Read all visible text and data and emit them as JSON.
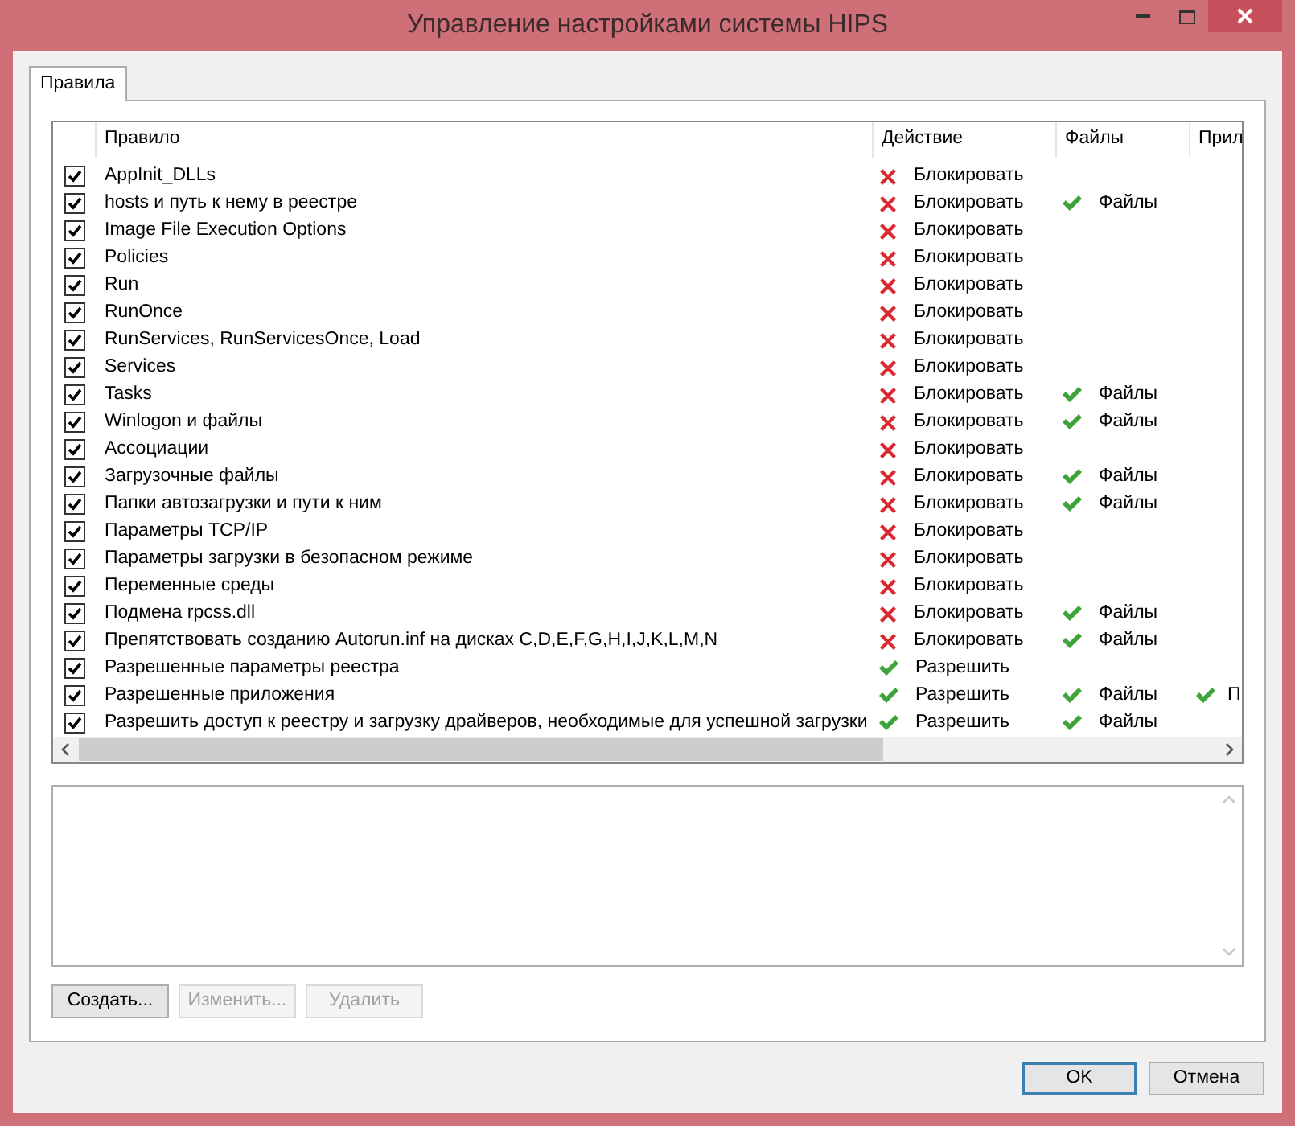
{
  "window": {
    "title": "Управление настройками системы HIPS"
  },
  "tabs": [
    {
      "label": "Правила",
      "selected": true
    }
  ],
  "table": {
    "columns": [
      "Правило",
      "Действие",
      "Файлы",
      "Прил"
    ],
    "rows": [
      {
        "checked": true,
        "rule": "AppInit_DLLs",
        "action": {
          "kind": "block",
          "label": "Блокировать"
        }
      },
      {
        "checked": true,
        "rule": "hosts и путь к нему в реестре",
        "action": {
          "kind": "block",
          "label": "Блокировать"
        },
        "files": "Файлы"
      },
      {
        "checked": true,
        "rule": "Image File Execution Options",
        "action": {
          "kind": "block",
          "label": "Блокировать"
        }
      },
      {
        "checked": true,
        "rule": "Policies",
        "action": {
          "kind": "block",
          "label": "Блокировать"
        }
      },
      {
        "checked": true,
        "rule": "Run",
        "action": {
          "kind": "block",
          "label": "Блокировать"
        }
      },
      {
        "checked": true,
        "rule": "RunOnce",
        "action": {
          "kind": "block",
          "label": "Блокировать"
        }
      },
      {
        "checked": true,
        "rule": "RunServices, RunServicesOnce, Load",
        "action": {
          "kind": "block",
          "label": "Блокировать"
        }
      },
      {
        "checked": true,
        "rule": "Services",
        "action": {
          "kind": "block",
          "label": "Блокировать"
        }
      },
      {
        "checked": true,
        "rule": "Tasks",
        "action": {
          "kind": "block",
          "label": "Блокировать"
        },
        "files": "Файлы"
      },
      {
        "checked": true,
        "rule": "Winlogon и файлы",
        "action": {
          "kind": "block",
          "label": "Блокировать"
        },
        "files": "Файлы"
      },
      {
        "checked": true,
        "rule": "Ассоциации",
        "action": {
          "kind": "block",
          "label": "Блокировать"
        }
      },
      {
        "checked": true,
        "rule": "Загрузочные файлы",
        "action": {
          "kind": "block",
          "label": "Блокировать"
        },
        "files": "Файлы"
      },
      {
        "checked": true,
        "rule": "Папки автозагрузки и пути к ним",
        "action": {
          "kind": "block",
          "label": "Блокировать"
        },
        "files": "Файлы"
      },
      {
        "checked": true,
        "rule": "Параметры TCP/IP",
        "action": {
          "kind": "block",
          "label": "Блокировать"
        }
      },
      {
        "checked": true,
        "rule": "Параметры загрузки в безопасном режиме",
        "action": {
          "kind": "block",
          "label": "Блокировать"
        }
      },
      {
        "checked": true,
        "rule": "Переменные среды",
        "action": {
          "kind": "block",
          "label": "Блокировать"
        }
      },
      {
        "checked": true,
        "rule": "Подмена rpcss.dll",
        "action": {
          "kind": "block",
          "label": "Блокировать"
        },
        "files": "Файлы"
      },
      {
        "checked": true,
        "rule": "Препятствовать созданию Autorun.inf на дисках C,D,E,F,G,H,I,J,K,L,M,N",
        "action": {
          "kind": "block",
          "label": "Блокировать"
        },
        "files": "Файлы"
      },
      {
        "checked": true,
        "rule": "Разрешенные параметры реестра",
        "action": {
          "kind": "allow",
          "label": "Разрешить"
        }
      },
      {
        "checked": true,
        "rule": "Разрешенные приложения",
        "action": {
          "kind": "allow",
          "label": "Разрешить"
        },
        "files": "Файлы",
        "apps": "П"
      },
      {
        "checked": true,
        "rule": "Разрешить доступ к реестру и загрузку драйверов, необходимые для успешной загрузки",
        "action": {
          "kind": "allow",
          "label": "Разрешить"
        },
        "files": "Файлы"
      }
    ]
  },
  "buttons": [
    {
      "label": "Создать...",
      "disabled": false
    },
    {
      "label": "Изменить...",
      "disabled": true
    },
    {
      "label": "Удалить",
      "disabled": true
    }
  ],
  "dialog_buttons": [
    {
      "label": "OK",
      "default": true
    },
    {
      "label": "Отмена",
      "default": false
    }
  ]
}
